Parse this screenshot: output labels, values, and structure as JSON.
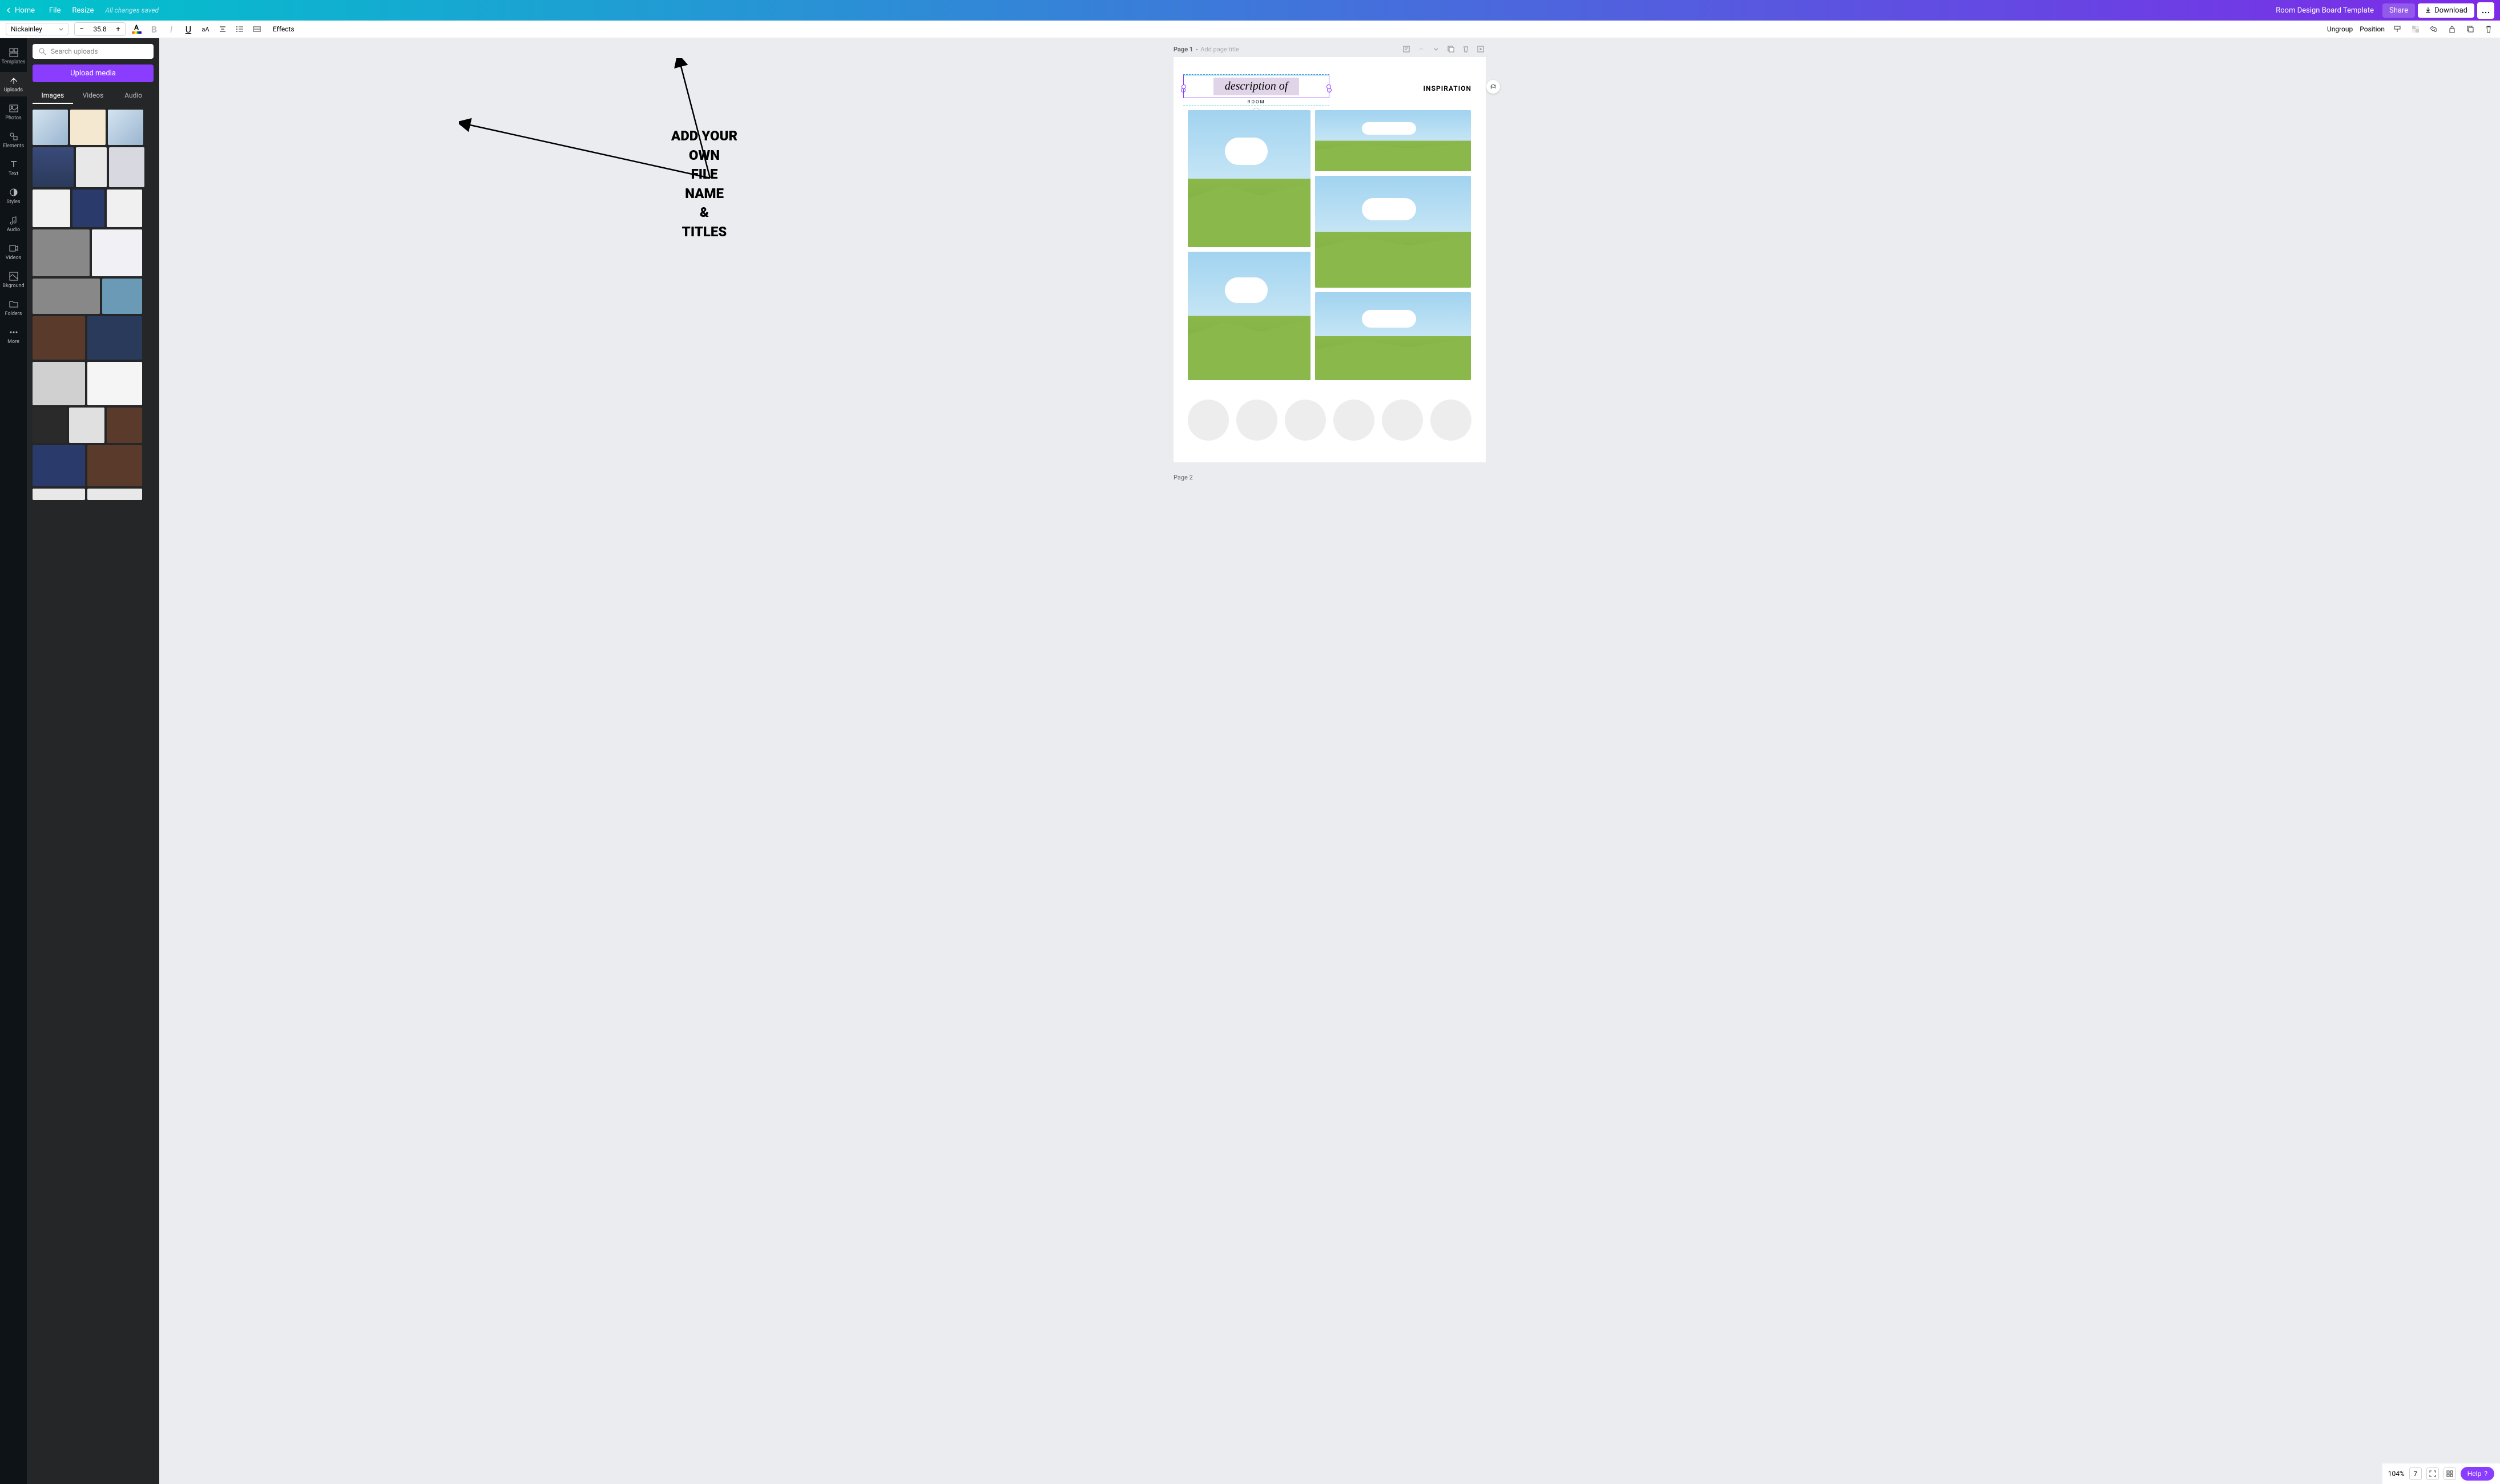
{
  "topbar": {
    "home": "Home",
    "file": "File",
    "resize": "Resize",
    "saved": "All changes saved",
    "doc_title": "Room Design Board Template",
    "share": "Share",
    "download": "Download"
  },
  "context": {
    "font": "Nickainley",
    "size": "35.8",
    "effects": "Effects",
    "ungroup": "Ungroup",
    "position": "Position"
  },
  "vnav": {
    "templates": "Templates",
    "uploads": "Uploads",
    "photos": "Photos",
    "elements": "Elements",
    "text": "Text",
    "styles": "Styles",
    "audio": "Audio",
    "videos": "Videos",
    "bkground": "Bkground",
    "folders": "Folders",
    "more": "More"
  },
  "panel": {
    "search_placeholder": "Search uploads",
    "upload": "Upload media",
    "tab_images": "Images",
    "tab_videos": "Videos",
    "tab_audio": "Audio"
  },
  "canvas": {
    "page1": "Page 1",
    "page_title_placeholder": "Add page title",
    "desc_text": "description of",
    "room_text": "ROOM",
    "inspiration": "INSPIRATION",
    "page2": "Page 2"
  },
  "annotation": {
    "l1": "ADD YOUR",
    "l2": "OWN",
    "l3": "FILE",
    "l4": "NAME",
    "l5": "&",
    "l6": "TITLES"
  },
  "bottom": {
    "zoom": "104%",
    "pages": "7",
    "help": "Help"
  }
}
